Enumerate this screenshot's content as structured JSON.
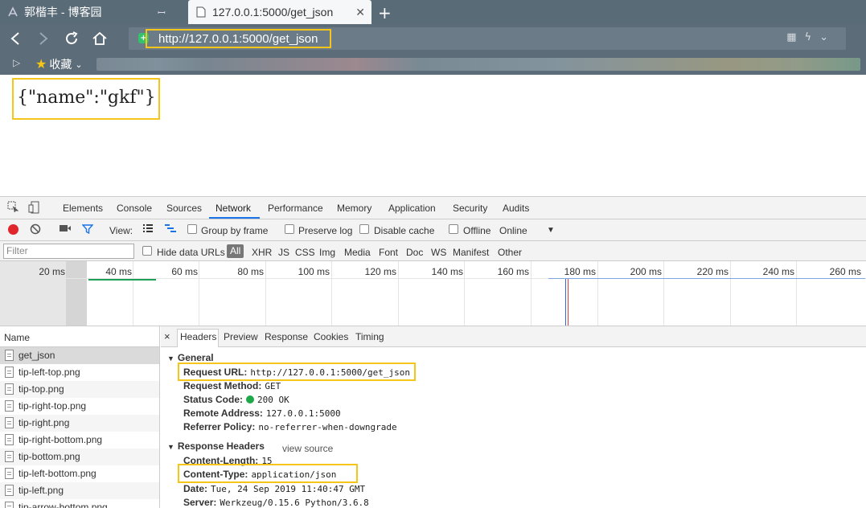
{
  "browser": {
    "tabs": [
      {
        "title": "郭楷丰 - 博客园",
        "active": false
      },
      {
        "title": "127.0.0.1:5000/get_json",
        "active": true
      }
    ],
    "new_tab_label": "+",
    "url": "http://127.0.0.1:5000/get_json",
    "bookmarks_label": "收藏",
    "accent_color": "#f5c518"
  },
  "page": {
    "json_text": "{\"name\":\"gkf\"}"
  },
  "devtools": {
    "tabs": [
      "Elements",
      "Console",
      "Sources",
      "Network",
      "Performance",
      "Memory",
      "Application",
      "Security",
      "Audits"
    ],
    "active_tab": "Network",
    "toolbar": {
      "view_label": "View:",
      "group_by_frame": "Group by frame",
      "preserve_log": "Preserve log",
      "disable_cache": "Disable cache",
      "offline": "Offline",
      "throttle": "Online"
    },
    "filter": {
      "placeholder": "Filter",
      "hide_data_urls": "Hide data URLs",
      "types": [
        "All",
        "XHR",
        "JS",
        "CSS",
        "Img",
        "Media",
        "Font",
        "Doc",
        "WS",
        "Manifest",
        "Other"
      ]
    },
    "timeline_ticks": [
      "20 ms",
      "40 ms",
      "60 ms",
      "80 ms",
      "100 ms",
      "120 ms",
      "140 ms",
      "160 ms",
      "180 ms",
      "200 ms",
      "220 ms",
      "240 ms",
      "260 ms"
    ],
    "requests": {
      "column_name": "Name",
      "items": [
        "get_json",
        "tip-left-top.png",
        "tip-top.png",
        "tip-right-top.png",
        "tip-right.png",
        "tip-right-bottom.png",
        "tip-bottom.png",
        "tip-left-bottom.png",
        "tip-left.png",
        "tip-arrow-bottom.png"
      ]
    },
    "detail_tabs": [
      "Headers",
      "Preview",
      "Response",
      "Cookies",
      "Timing"
    ],
    "detail_close": "×",
    "general": {
      "title": "General",
      "request_url_label": "Request URL:",
      "request_url": "http://127.0.0.1:5000/get_json",
      "method_label": "Request Method:",
      "method": "GET",
      "status_label": "Status Code:",
      "status": "200 OK",
      "remote_label": "Remote Address:",
      "remote": "127.0.0.1:5000",
      "referrer_label": "Referrer Policy:",
      "referrer": "no-referrer-when-downgrade"
    },
    "response_headers": {
      "title": "Response Headers",
      "view_source": "view source",
      "content_length_label": "Content-Length:",
      "content_length": "15",
      "content_type_label": "Content-Type:",
      "content_type": "application/json",
      "date_label": "Date:",
      "date": "Tue, 24 Sep 2019 11:40:47 GMT",
      "server_label": "Server:",
      "server": "Werkzeug/0.15.6 Python/3.6.8"
    }
  }
}
